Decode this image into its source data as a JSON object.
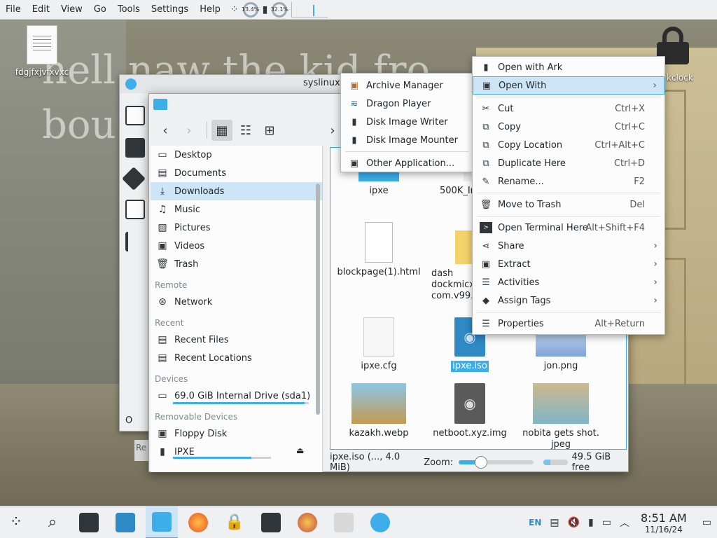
{
  "menubar": {
    "items": [
      "File",
      "Edit",
      "View",
      "Go",
      "Tools",
      "Settings",
      "Help"
    ],
    "cpu1": "13.4%",
    "cpu2": "32.1%"
  },
  "desktop": {
    "file_icon_label": "fdgjfxjvfxvxc",
    "lock_label": "kclock",
    "wallpaper_caption_line1": "hell naw the kid fro",
    "wallpaper_caption_line2": "bou"
  },
  "background_window": {
    "title": "syslinux.c",
    "bottom_text": "O",
    "bottom_text2": "Re"
  },
  "file_manager": {
    "places": {
      "items": [
        {
          "label": "Desktop",
          "icon": "desktop-icon"
        },
        {
          "label": "Documents",
          "icon": "documents-icon"
        },
        {
          "label": "Downloads",
          "icon": "downloads-icon"
        },
        {
          "label": "Music",
          "icon": "music-icon"
        },
        {
          "label": "Pictures",
          "icon": "pictures-icon"
        },
        {
          "label": "Videos",
          "icon": "videos-icon"
        },
        {
          "label": "Trash",
          "icon": "trash-icon"
        }
      ],
      "remote_header": "Remote",
      "network": "Network",
      "recent_header": "Recent",
      "recent_files": "Recent Files",
      "recent_locations": "Recent Locations",
      "devices_header": "Devices",
      "internal_drive": "69.0 GiB Internal Drive (sda1)",
      "internal_drive_usage": 0.97,
      "removable_header": "Removable Devices",
      "floppy": "Floppy Disk",
      "ipxe_drive": "IPXE",
      "ipxe_usage": 0.8
    },
    "files": [
      {
        "label": "ipxe"
      },
      {
        "label": "500K_Ir"
      },
      {
        "label": "blockpage(1).html"
      },
      {
        "label": "dash\ndockmicx\ncom.v99.s"
      },
      {
        "label": "ipxe.cfg"
      },
      {
        "label": "ipxe.iso"
      },
      {
        "label": "jon.png"
      },
      {
        "label": "kazakh.webp"
      },
      {
        "label": "netboot.xyz.img"
      },
      {
        "label": "nobita gets shot.\njpeg"
      }
    ],
    "status": {
      "selection": "ipxe.iso (..., 4.0 MiB)",
      "zoom_label": "Zoom:",
      "zoom_level": 0.3,
      "free": "49.5 GiB free",
      "free_fill": 0.3
    }
  },
  "open_with_submenu": {
    "items": [
      {
        "label": "Archive Manager",
        "icon": "archive-manager-icon"
      },
      {
        "label": "Dragon Player",
        "icon": "dragon-player-icon"
      },
      {
        "label": "Disk Image Writer",
        "icon": "disk-writer-icon"
      },
      {
        "label": "Disk Image Mounter",
        "icon": "disk-mounter-icon"
      }
    ],
    "other": "Other Application..."
  },
  "context_menu": {
    "open_with_ark": "Open with Ark",
    "open_with": "Open With",
    "cut": "Cut",
    "cut_sc": "Ctrl+X",
    "copy": "Copy",
    "copy_sc": "Ctrl+C",
    "copy_location": "Copy Location",
    "copy_location_sc": "Ctrl+Alt+C",
    "duplicate": "Duplicate Here",
    "duplicate_sc": "Ctrl+D",
    "rename": "Rename...",
    "rename_sc": "F2",
    "trash": "Move to Trash",
    "trash_sc": "Del",
    "terminal": "Open Terminal Here",
    "terminal_sc": "Alt+Shift+F4",
    "share": "Share",
    "extract": "Extract",
    "activities": "Activities",
    "assign_tags": "Assign Tags",
    "properties": "Properties",
    "properties_sc": "Alt+Return"
  },
  "taskbar": {
    "lang": "EN",
    "time": "8:51 AM",
    "date": "11/16/24"
  },
  "colors": {
    "accent": "#3daee9",
    "selection": "#cde6f7"
  }
}
